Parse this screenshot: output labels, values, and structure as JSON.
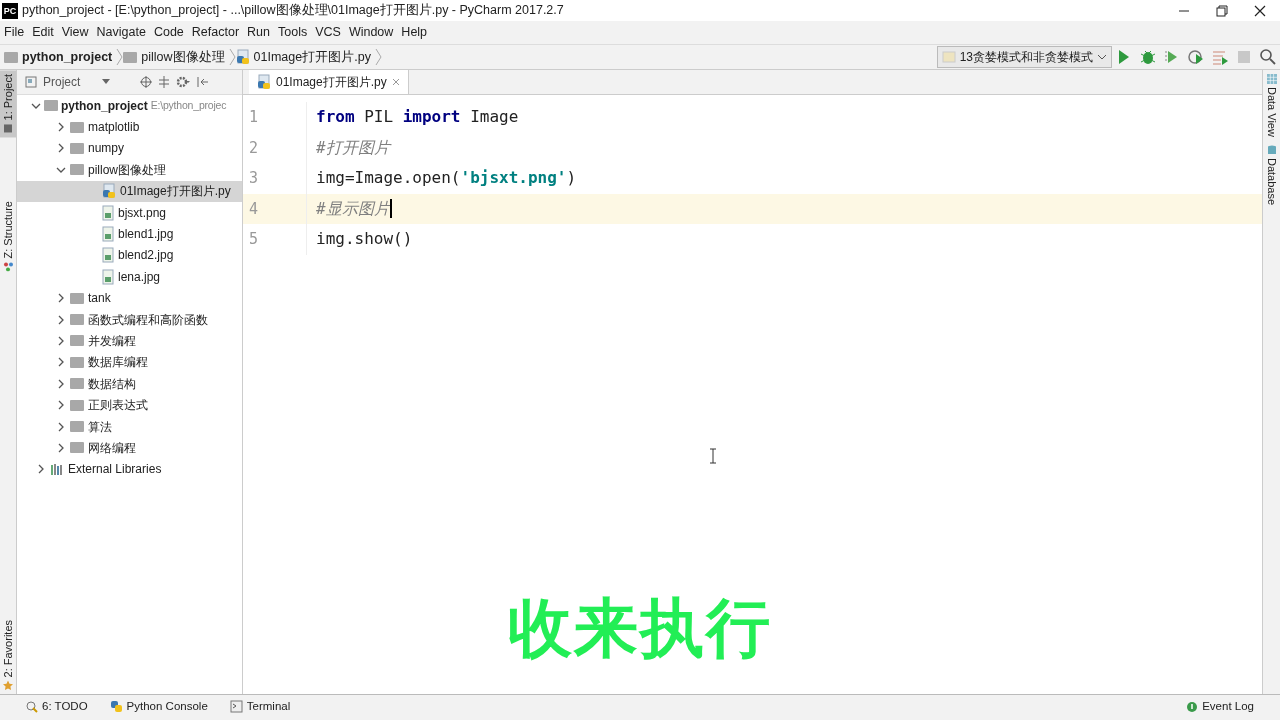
{
  "window": {
    "logo": "PC",
    "title": "python_project - [E:\\python_project] - ...\\pillow图像处理\\01Image打开图片.py - PyCharm 2017.2.7"
  },
  "menu": [
    "File",
    "Edit",
    "View",
    "Navigate",
    "Code",
    "Refactor",
    "Run",
    "Tools",
    "VCS",
    "Window",
    "Help"
  ],
  "breadcrumbs": [
    {
      "label": "python_project",
      "kind": "project"
    },
    {
      "label": "pillow图像处理",
      "kind": "folder"
    },
    {
      "label": "01Image打开图片.py",
      "kind": "python"
    }
  ],
  "run_config": {
    "label": "13贪婪模式和非贪婪模式"
  },
  "left_stripe": [
    {
      "label": "1: Project",
      "kind": "project",
      "selected": true
    },
    {
      "label": "Z: Structure",
      "kind": "structure",
      "selected": false
    },
    {
      "label": "2: Favorites",
      "kind": "favorites",
      "selected": false
    }
  ],
  "project_panel": {
    "title": "Project"
  },
  "tree": [
    {
      "label": "python_project",
      "path": "E:\\python_projec",
      "kind": "folder",
      "expanded": true,
      "selected": false,
      "children": [
        {
          "label": "matplotlib",
          "kind": "folder",
          "expanded": false,
          "selected": false
        },
        {
          "label": "numpy",
          "kind": "folder",
          "expanded": false,
          "selected": false
        },
        {
          "label": "pillow图像处理",
          "kind": "folder",
          "expanded": true,
          "selected": false,
          "children": [
            {
              "label": "01Image打开图片.py",
              "kind": "python",
              "selected": true
            },
            {
              "label": "bjsxt.png",
              "kind": "image",
              "selected": false
            },
            {
              "label": "blend1.jpg",
              "kind": "image",
              "selected": false
            },
            {
              "label": "blend2.jpg",
              "kind": "image",
              "selected": false
            },
            {
              "label": "lena.jpg",
              "kind": "image",
              "selected": false
            }
          ]
        },
        {
          "label": "tank",
          "kind": "folder",
          "expanded": false,
          "selected": false
        },
        {
          "label": "函数式编程和高阶函数",
          "kind": "folder",
          "expanded": false,
          "selected": false
        },
        {
          "label": "并发编程",
          "kind": "folder",
          "expanded": false,
          "selected": false
        },
        {
          "label": "数据库编程",
          "kind": "folder",
          "expanded": false,
          "selected": false
        },
        {
          "label": "数据结构",
          "kind": "folder",
          "expanded": false,
          "selected": false
        },
        {
          "label": "正则表达式",
          "kind": "folder",
          "expanded": false,
          "selected": false
        },
        {
          "label": "算法",
          "kind": "folder",
          "expanded": false,
          "selected": false
        },
        {
          "label": "网络编程",
          "kind": "folder",
          "expanded": false,
          "selected": false
        }
      ]
    },
    {
      "label": "External Libraries",
      "kind": "library",
      "expanded": false,
      "selected": false
    }
  ],
  "editor_tabs": [
    {
      "label": "01Image打开图片.py",
      "selected": true
    }
  ],
  "code": [
    {
      "number": "1",
      "current": false,
      "tokens": [
        {
          "text": "from",
          "kind": "keyword"
        },
        {
          "text": " PIL ",
          "kind": "plain"
        },
        {
          "text": "import",
          "kind": "keyword"
        },
        {
          "text": " Image",
          "kind": "plain"
        }
      ]
    },
    {
      "number": "2",
      "current": false,
      "tokens": [
        {
          "text": "#打开图片",
          "kind": "comment"
        }
      ]
    },
    {
      "number": "3",
      "current": false,
      "tokens": [
        {
          "text": "img=Image.open(",
          "kind": "plain"
        },
        {
          "text": "'bjsxt.png'",
          "kind": "string"
        },
        {
          "text": ")",
          "kind": "plain"
        }
      ]
    },
    {
      "number": "4",
      "current": true,
      "tokens": [
        {
          "text": "#显示图片",
          "kind": "comment"
        }
      ]
    },
    {
      "number": "5",
      "current": false,
      "tokens": [
        {
          "text": "img.show()",
          "kind": "plain"
        }
      ]
    }
  ],
  "right_stripe": [
    "Data View",
    "Database"
  ],
  "subtitle": "收来执行",
  "bottom_tools": [
    {
      "label": "6: TODO",
      "kind": "todo"
    },
    {
      "label": "Python Console",
      "kind": "console"
    },
    {
      "label": "Terminal",
      "kind": "terminal"
    }
  ],
  "event_log": {
    "label": "Event Log"
  }
}
